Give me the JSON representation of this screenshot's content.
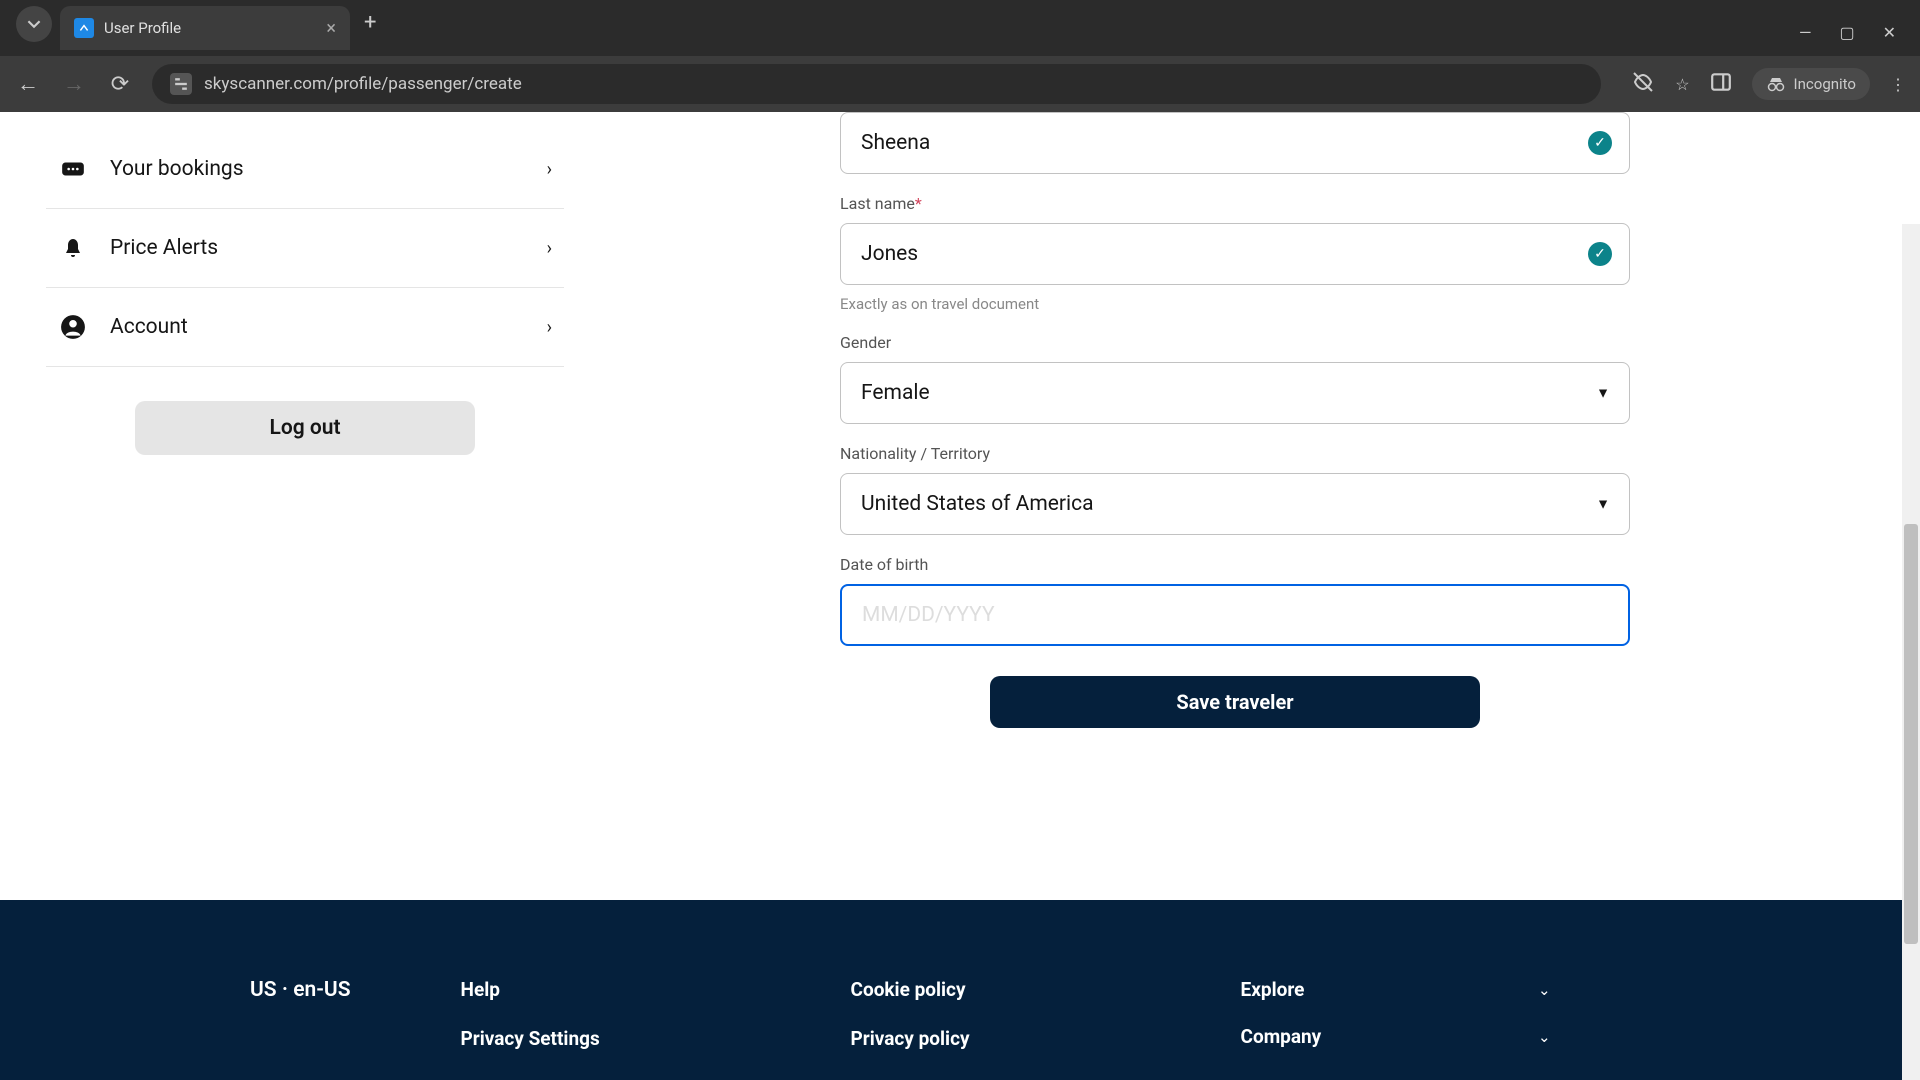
{
  "browser": {
    "tab_title": "User Profile",
    "url": "skyscanner.com/profile/passenger/create",
    "incognito_label": "Incognito"
  },
  "sidebar": {
    "items": [
      {
        "label": "Your bookings"
      },
      {
        "label": "Price Alerts"
      },
      {
        "label": "Account"
      }
    ],
    "logout_label": "Log out"
  },
  "form": {
    "first_name": {
      "value": "Sheena"
    },
    "last_name": {
      "label": "Last name",
      "value": "Jones",
      "hint": "Exactly as on travel document"
    },
    "gender": {
      "label": "Gender",
      "value": "Female"
    },
    "nationality": {
      "label": "Nationality / Territory",
      "value": "United States of America"
    },
    "dob": {
      "label": "Date of birth",
      "placeholder": "MM/DD/YYYY",
      "value": ""
    },
    "save_label": "Save traveler"
  },
  "footer": {
    "locale": "US · en-US",
    "col1": [
      "Help",
      "Privacy Settings"
    ],
    "col2": [
      "Cookie policy",
      "Privacy policy"
    ],
    "acc": [
      "Explore",
      "Company"
    ]
  }
}
